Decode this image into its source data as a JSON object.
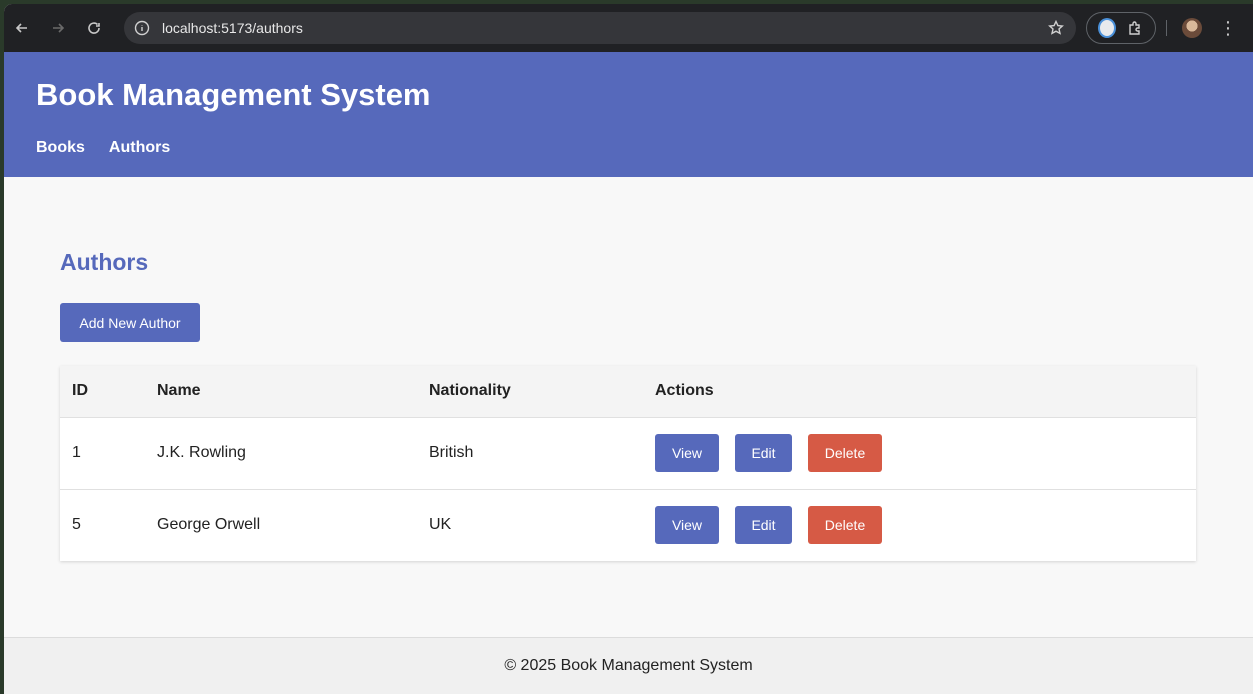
{
  "browser": {
    "url": "localhost:5173/authors",
    "icons": [
      "back-arrow-icon",
      "forward-arrow-icon",
      "reload-icon",
      "site-info-icon",
      "bookmark-star-icon",
      "extension-icon",
      "puzzle-icon",
      "profile-avatar",
      "kebab-menu-icon"
    ]
  },
  "header": {
    "title": "Book Management System",
    "nav": [
      {
        "label": "Books"
      },
      {
        "label": "Authors"
      }
    ],
    "background": "#5669bb"
  },
  "main": {
    "title": "Authors",
    "add_button": "Add New Author",
    "table": {
      "columns": [
        "ID",
        "Name",
        "Nationality",
        "Actions"
      ],
      "rows": [
        {
          "id": "1",
          "name": "J.K. Rowling",
          "nationality": "British"
        },
        {
          "id": "5",
          "name": "George Orwell",
          "nationality": "UK"
        }
      ],
      "actions": {
        "view": "View",
        "edit": "Edit",
        "delete": "Delete"
      }
    }
  },
  "footer": {
    "text": "© 2025 Book Management System"
  },
  "colors": {
    "primary": "#5669bb",
    "danger": "#d65a45"
  }
}
